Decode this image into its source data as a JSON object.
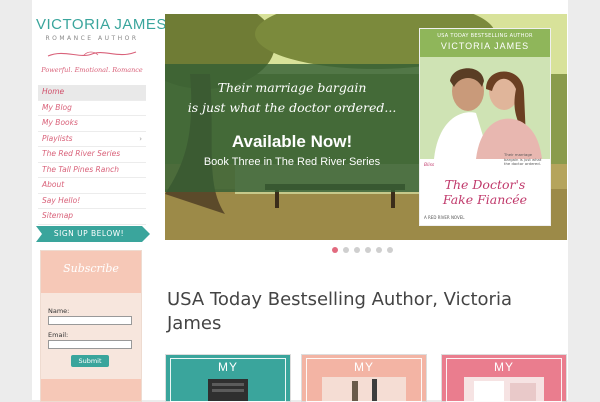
{
  "brand": {
    "name": "VICTORIA JAMES",
    "subtitle": "ROMANCE AUTHOR",
    "tagline": "Powerful. Emotional. Romance",
    "accent": "#3aa59c",
    "pink": "#d9627a"
  },
  "nav": {
    "items": [
      {
        "label": "Home"
      },
      {
        "label": "My Blog"
      },
      {
        "label": "My Books"
      },
      {
        "label": "Playlists"
      },
      {
        "label": "The Red River Series"
      },
      {
        "label": "The Tall Pines Ranch"
      },
      {
        "label": "About"
      },
      {
        "label": "Say Hello!"
      },
      {
        "label": "Sitemap"
      }
    ],
    "active_index": 0
  },
  "signup": {
    "banner": "SIGN UP BELOW!",
    "title": "Subscribe",
    "name_label": "Name:",
    "email_label": "Email:",
    "button": "Submit"
  },
  "slider": {
    "line1": "Their marriage bargain",
    "line2": "is just what the doctor ordered...",
    "available": "Available Now!",
    "series": "Book Three in The Red River Series",
    "cover": {
      "top": "USA TODAY BESTSELLING AUTHOR",
      "author": "VICTORIA JAMES",
      "imprint": "Bliss",
      "blurb": "Their marriage bargain is just what the doctor ordered.",
      "title1": "The Doctor's",
      "title2": "Fake Fiancée",
      "series": "A RED RIVER NOVEL"
    },
    "slide_count": 6,
    "current_slide": 1
  },
  "headline": "USA Today Bestselling Author, Victoria James",
  "cards": [
    {
      "label": "MY",
      "color": "#3aa59c"
    },
    {
      "label": "MY",
      "color": "#f3b4a4"
    },
    {
      "label": "MY",
      "color": "#ea7d8e"
    }
  ]
}
